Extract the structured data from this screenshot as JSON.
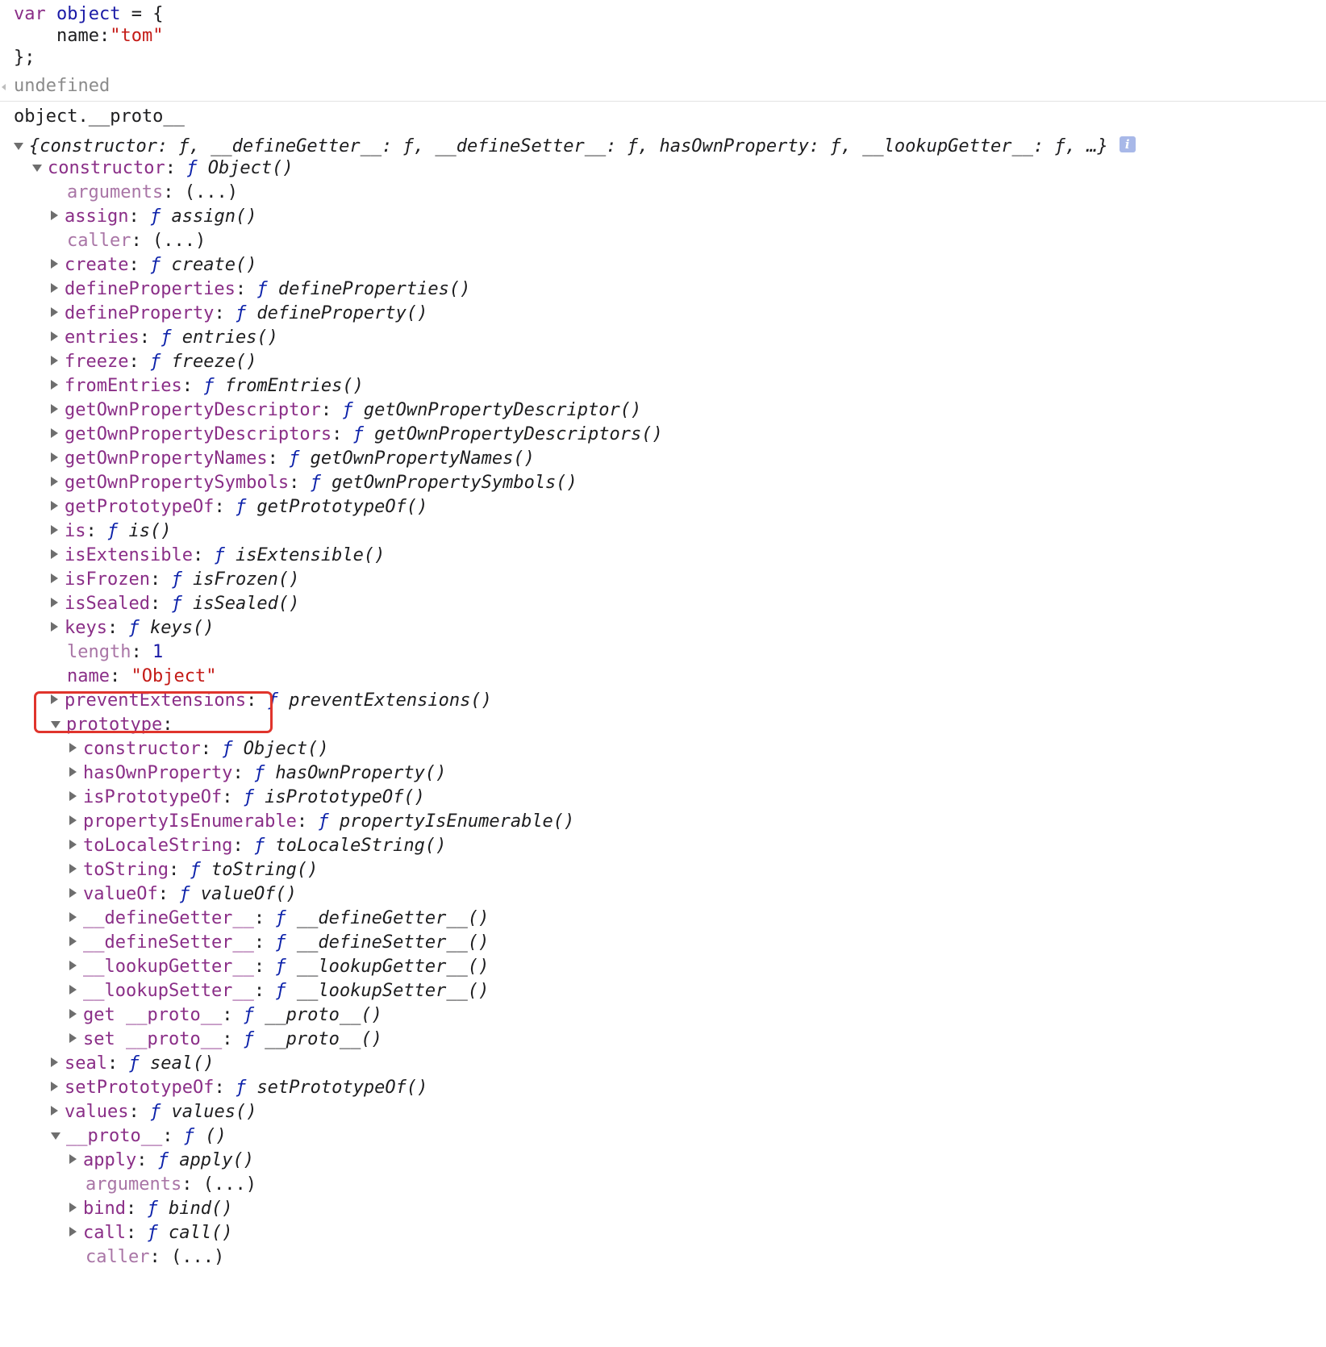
{
  "input1": {
    "line1": {
      "kw": "var",
      "name": "object",
      "rest": " = {"
    },
    "line2": {
      "indent": "    ",
      "key": "name:",
      "value": "\"tom\""
    },
    "line3": "};"
  },
  "result1": "undefined",
  "input2": "object.__proto__",
  "summary": "{constructor: ƒ, __defineGetter__: ƒ, __defineSetter__: ƒ, hasOwnProperty: ƒ, __lookupGetter__: ƒ, …}",
  "info_icon_label": "i",
  "tree": [
    {
      "key": "constructor",
      "level": 1,
      "tri": "expanded",
      "type": "func",
      "fname": "Object()"
    },
    {
      "key": "arguments",
      "level": 2,
      "tri": "none",
      "type": "plain",
      "text": "(...)"
    },
    {
      "key": "assign",
      "level": 2,
      "tri": "collapsed",
      "type": "func",
      "fname": "assign()"
    },
    {
      "key": "caller",
      "level": 2,
      "tri": "none",
      "type": "plain",
      "text": "(...)"
    },
    {
      "key": "create",
      "level": 2,
      "tri": "collapsed",
      "type": "func",
      "fname": "create()"
    },
    {
      "key": "defineProperties",
      "level": 2,
      "tri": "collapsed",
      "type": "func",
      "fname": "defineProperties()"
    },
    {
      "key": "defineProperty",
      "level": 2,
      "tri": "collapsed",
      "type": "func",
      "fname": "defineProperty()"
    },
    {
      "key": "entries",
      "level": 2,
      "tri": "collapsed",
      "type": "func",
      "fname": "entries()"
    },
    {
      "key": "freeze",
      "level": 2,
      "tri": "collapsed",
      "type": "func",
      "fname": "freeze()"
    },
    {
      "key": "fromEntries",
      "level": 2,
      "tri": "collapsed",
      "type": "func",
      "fname": "fromEntries()"
    },
    {
      "key": "getOwnPropertyDescriptor",
      "level": 2,
      "tri": "collapsed",
      "type": "func",
      "fname": "getOwnPropertyDescriptor()"
    },
    {
      "key": "getOwnPropertyDescriptors",
      "level": 2,
      "tri": "collapsed",
      "type": "func",
      "fname": "getOwnPropertyDescriptors()"
    },
    {
      "key": "getOwnPropertyNames",
      "level": 2,
      "tri": "collapsed",
      "type": "func",
      "fname": "getOwnPropertyNames()"
    },
    {
      "key": "getOwnPropertySymbols",
      "level": 2,
      "tri": "collapsed",
      "type": "func",
      "fname": "getOwnPropertySymbols()"
    },
    {
      "key": "getPrototypeOf",
      "level": 2,
      "tri": "collapsed",
      "type": "func",
      "fname": "getPrototypeOf()"
    },
    {
      "key": "is",
      "level": 2,
      "tri": "collapsed",
      "type": "func",
      "fname": "is()"
    },
    {
      "key": "isExtensible",
      "level": 2,
      "tri": "collapsed",
      "type": "func",
      "fname": "isExtensible()"
    },
    {
      "key": "isFrozen",
      "level": 2,
      "tri": "collapsed",
      "type": "func",
      "fname": "isFrozen()"
    },
    {
      "key": "isSealed",
      "level": 2,
      "tri": "collapsed",
      "type": "func",
      "fname": "isSealed()"
    },
    {
      "key": "keys",
      "level": 2,
      "tri": "collapsed",
      "type": "func",
      "fname": "keys()"
    },
    {
      "key": "length",
      "level": 2,
      "tri": "none",
      "type": "num",
      "text": "1"
    },
    {
      "key": "name",
      "level": 2,
      "tri": "none",
      "type": "str",
      "text": "\"Object\""
    },
    {
      "key": "preventExtensions",
      "level": 2,
      "tri": "collapsed",
      "type": "func",
      "fname": "preventExtensions()"
    },
    {
      "key": "prototype",
      "level": 2,
      "tri": "expanded",
      "type": "empty"
    },
    {
      "key": "constructor",
      "level": 3,
      "tri": "collapsed",
      "type": "func",
      "fname": "Object()"
    },
    {
      "key": "hasOwnProperty",
      "level": 3,
      "tri": "collapsed",
      "type": "func",
      "fname": "hasOwnProperty()"
    },
    {
      "key": "isPrototypeOf",
      "level": 3,
      "tri": "collapsed",
      "type": "func",
      "fname": "isPrototypeOf()"
    },
    {
      "key": "propertyIsEnumerable",
      "level": 3,
      "tri": "collapsed",
      "type": "func",
      "fname": "propertyIsEnumerable()"
    },
    {
      "key": "toLocaleString",
      "level": 3,
      "tri": "collapsed",
      "type": "func",
      "fname": "toLocaleString()"
    },
    {
      "key": "toString",
      "level": 3,
      "tri": "collapsed",
      "type": "func",
      "fname": "toString()"
    },
    {
      "key": "valueOf",
      "level": 3,
      "tri": "collapsed",
      "type": "func",
      "fname": "valueOf()"
    },
    {
      "key": "__defineGetter__",
      "level": 3,
      "tri": "collapsed",
      "type": "func",
      "fname": "__defineGetter__()"
    },
    {
      "key": "__defineSetter__",
      "level": 3,
      "tri": "collapsed",
      "type": "func",
      "fname": "__defineSetter__()"
    },
    {
      "key": "__lookupGetter__",
      "level": 3,
      "tri": "collapsed",
      "type": "func",
      "fname": "__lookupGetter__()"
    },
    {
      "key": "__lookupSetter__",
      "level": 3,
      "tri": "collapsed",
      "type": "func",
      "fname": "__lookupSetter__()"
    },
    {
      "key": "get __proto__",
      "level": 3,
      "tri": "collapsed",
      "type": "func",
      "fname": "__proto__()"
    },
    {
      "key": "set __proto__",
      "level": 3,
      "tri": "collapsed",
      "type": "func",
      "fname": "__proto__()"
    },
    {
      "key": "seal",
      "level": 2,
      "tri": "collapsed",
      "type": "func",
      "fname": "seal()"
    },
    {
      "key": "setPrototypeOf",
      "level": 2,
      "tri": "collapsed",
      "type": "func",
      "fname": "setPrototypeOf()"
    },
    {
      "key": "values",
      "level": 2,
      "tri": "collapsed",
      "type": "func",
      "fname": "values()"
    },
    {
      "key": "__proto__",
      "level": 2,
      "tri": "expanded",
      "type": "func",
      "fname": "()"
    },
    {
      "key": "apply",
      "level": 3,
      "tri": "collapsed",
      "type": "func",
      "fname": "apply()"
    },
    {
      "key": "arguments",
      "level": 3,
      "tri": "none",
      "type": "plain",
      "text": "(...)"
    },
    {
      "key": "bind",
      "level": 3,
      "tri": "collapsed",
      "type": "func",
      "fname": "bind()"
    },
    {
      "key": "call",
      "level": 3,
      "tri": "collapsed",
      "type": "func",
      "fname": "call()"
    },
    {
      "key": "caller",
      "level": 3,
      "tri": "none",
      "type": "plain",
      "text": "(...)"
    }
  ],
  "func_keyword": "ƒ",
  "highlight_color": "#e0342c"
}
